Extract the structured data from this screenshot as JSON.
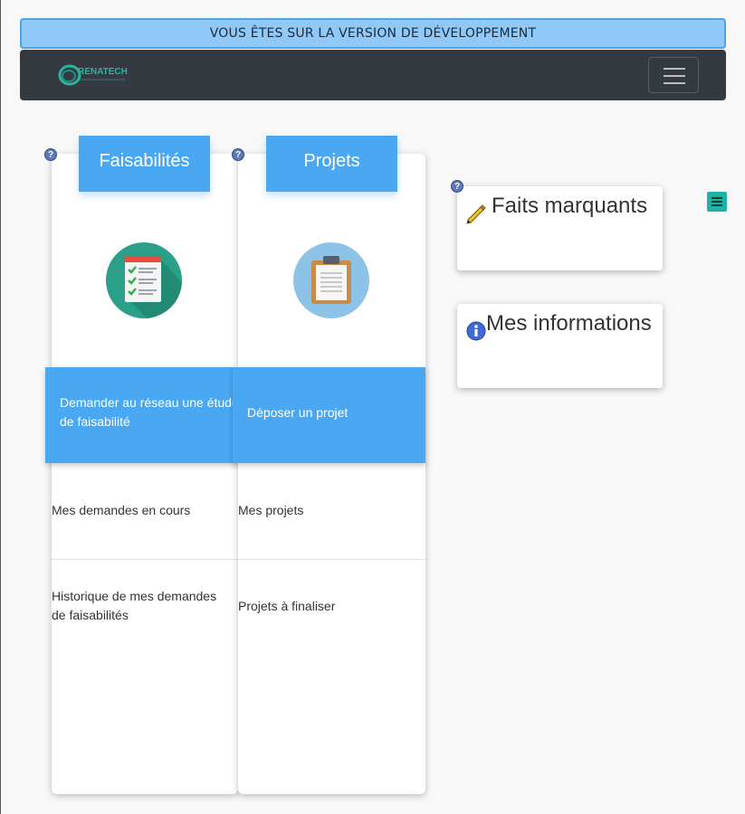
{
  "banner": {
    "text": "VOUS ÊTES SUR LA VERSION DE DÉVELOPPEMENT"
  },
  "navbar": {
    "logo_text": "RENATECH"
  },
  "columns": [
    {
      "title": "Faisabilités",
      "icon": "checklist-icon",
      "action": "Demander au réseau une étude de faisabilité",
      "links": [
        "Mes demandes en cours",
        "Historique de mes demandes de faisabilités"
      ]
    },
    {
      "title": "Projets",
      "icon": "clipboard-icon",
      "action": "Déposer un projet",
      "links": [
        "Mes projets",
        "Projets à finaliser"
      ]
    }
  ],
  "side": {
    "highlights_title": "Faits marquants",
    "info_title": "Mes informations"
  },
  "help_glyph": "?",
  "colors": {
    "accent": "#4aa8f3",
    "navbar": "#343a40",
    "banner": "#90c8f8",
    "teal": "#20b2a8"
  }
}
